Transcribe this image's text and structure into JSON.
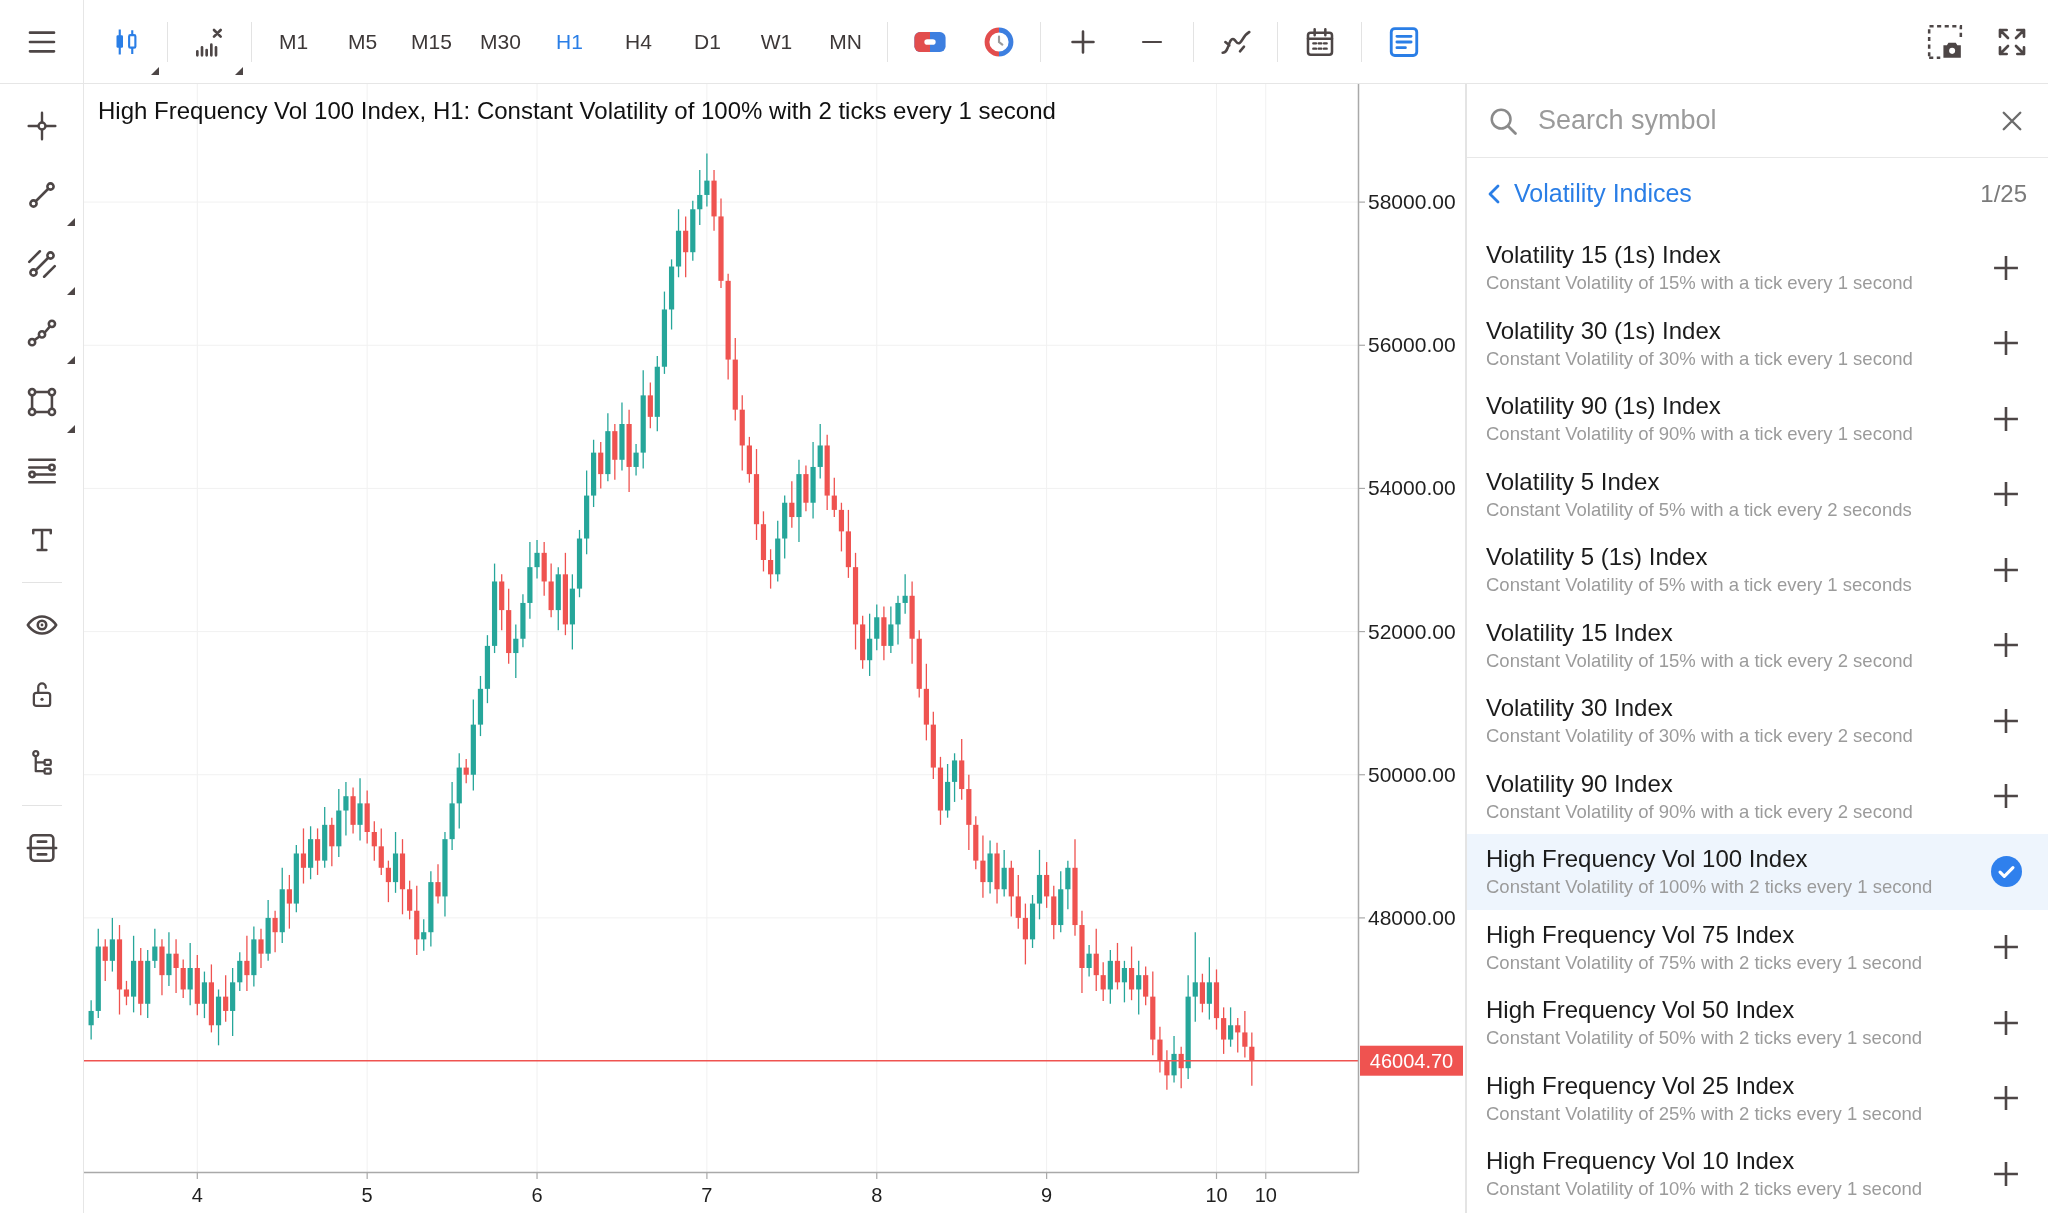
{
  "toolbar": {
    "chart_buttons": [
      {
        "kind": "candles",
        "active": true,
        "menu": true
      },
      {
        "kind": "indicators",
        "active": false,
        "menu": true
      }
    ],
    "timeframes": [
      {
        "label": "M1",
        "selected": false
      },
      {
        "label": "M5",
        "selected": false
      },
      {
        "label": "M15",
        "selected": false
      },
      {
        "label": "M30",
        "selected": false
      },
      {
        "label": "H1",
        "selected": true
      },
      {
        "label": "H4",
        "selected": false
      },
      {
        "label": "D1",
        "selected": false
      },
      {
        "label": "W1",
        "selected": false
      },
      {
        "label": "MN",
        "selected": false
      }
    ],
    "tool_groups": [
      [
        {
          "kind": "toggle",
          "active": false
        },
        {
          "kind": "ring",
          "active": false
        }
      ],
      [
        {
          "kind": "plus",
          "active": false
        },
        {
          "kind": "minus",
          "active": false
        }
      ],
      [
        {
          "kind": "curve",
          "active": false
        }
      ],
      [
        {
          "kind": "calendar",
          "active": false
        }
      ],
      [
        {
          "kind": "document",
          "active": true
        }
      ]
    ],
    "right_buttons": [
      {
        "kind": "camera",
        "active": false
      },
      {
        "kind": "fullscreen",
        "active": false
      }
    ]
  },
  "drawing_tools": [
    [
      {
        "kind": "crosshair",
        "menu": false
      },
      {
        "kind": "trend-line",
        "menu": true
      },
      {
        "kind": "channel",
        "menu": true
      },
      {
        "kind": "polyline",
        "menu": true
      },
      {
        "kind": "rectangle",
        "menu": true
      },
      {
        "kind": "lines",
        "menu": false
      },
      {
        "kind": "text",
        "menu": false
      }
    ],
    [
      {
        "kind": "eye",
        "menu": false
      },
      {
        "kind": "lock",
        "menu": false
      },
      {
        "kind": "tree",
        "menu": false
      }
    ],
    [
      {
        "kind": "stack",
        "menu": false
      }
    ]
  ],
  "chart": {
    "chart_data": [
      {
        "type": "candlestick",
        "title": "High Frequency Vol 100 Index, H1: Constant Volatility of 100% with 2 ticks every 1 second",
        "grid": true,
        "xlim": [
          3.333,
          10.833
        ],
        "ylim": [
          44450,
          59650
        ],
        "xticks": [
          4,
          5,
          6,
          7,
          8,
          9,
          10,
          {
            "value": 10.29,
            "label": "10"
          }
        ],
        "yticks": [
          {
            "value": 48000,
            "label": "48000.00"
          },
          {
            "value": 50000,
            "label": "50000.00"
          },
          {
            "value": 52000,
            "label": "52000.00"
          },
          {
            "value": 54000,
            "label": "54000.00"
          },
          {
            "value": 56000,
            "label": "56000.00"
          },
          {
            "value": 58000,
            "label": "58000.00"
          }
        ],
        "ref_lines": [
          {
            "axis": "y",
            "value": 46004.7,
            "label": "46004.70",
            "color": "#ef5350"
          }
        ],
        "x": [
          3.375,
          3.417,
          3.458,
          3.5,
          3.542,
          3.583,
          3.625,
          3.667,
          3.708,
          3.75,
          3.792,
          3.833,
          3.875,
          3.917,
          3.958,
          4,
          4.042,
          4.083,
          4.125,
          4.167,
          4.208,
          4.25,
          4.292,
          4.333,
          4.375,
          4.417,
          4.458,
          4.5,
          4.542,
          4.583,
          4.625,
          4.667,
          4.708,
          4.75,
          4.792,
          4.833,
          4.875,
          4.917,
          4.958,
          5,
          5.042,
          5.083,
          5.125,
          5.167,
          5.208,
          5.25,
          5.292,
          5.333,
          5.375,
          5.417,
          5.458,
          5.5,
          5.542,
          5.583,
          5.625,
          5.667,
          5.708,
          5.75,
          5.792,
          5.833,
          5.875,
          5.917,
          5.958,
          6,
          6.042,
          6.083,
          6.125,
          6.167,
          6.208,
          6.25,
          6.292,
          6.333,
          6.375,
          6.417,
          6.458,
          6.5,
          6.542,
          6.583,
          6.625,
          6.667,
          6.708,
          6.75,
          6.792,
          6.833,
          6.875,
          6.917,
          6.958,
          7,
          7.042,
          7.083,
          7.125,
          7.167,
          7.208,
          7.25,
          7.292,
          7.333,
          7.375,
          7.417,
          7.458,
          7.5,
          7.542,
          7.583,
          7.625,
          7.667,
          7.708,
          7.75,
          7.792,
          7.833,
          7.875,
          7.917,
          7.958,
          8,
          8.042,
          8.083,
          8.125,
          8.167,
          8.208,
          8.25,
          8.292,
          8.333,
          8.375,
          8.417,
          8.458,
          8.5,
          8.542,
          8.583,
          8.625,
          8.667,
          8.708,
          8.75,
          8.792,
          8.833,
          8.875,
          8.917,
          8.958,
          9,
          9.042,
          9.083,
          9.125,
          9.167,
          9.208,
          9.25,
          9.292,
          9.333,
          9.375,
          9.417,
          9.458,
          9.5,
          9.542,
          9.583,
          9.625,
          9.667,
          9.708,
          9.75,
          9.792,
          9.833,
          9.875,
          9.917,
          9.958,
          10,
          10.042,
          10.083,
          10.125,
          10.167,
          10.208
        ],
        "ohlc": [
          [
            46500,
            46850,
            46300,
            46700
          ],
          [
            46700,
            47850,
            46600,
            47600
          ],
          [
            47600,
            47700,
            47120,
            47400
          ],
          [
            47400,
            48000,
            47250,
            47700
          ],
          [
            47700,
            47900,
            46650,
            47000
          ],
          [
            47000,
            47120,
            46780,
            46900
          ],
          [
            46900,
            47750,
            46680,
            47400
          ],
          [
            47400,
            47580,
            46640,
            46800
          ],
          [
            46800,
            47550,
            46600,
            47400
          ],
          [
            47400,
            47850,
            47300,
            47600
          ],
          [
            47600,
            47700,
            46920,
            47200
          ],
          [
            47200,
            47800,
            47050,
            47500
          ],
          [
            47500,
            47700,
            46950,
            47300
          ],
          [
            47300,
            47420,
            46880,
            47000
          ],
          [
            47000,
            47650,
            46780,
            47300
          ],
          [
            47300,
            47480,
            46640,
            46800
          ],
          [
            46800,
            47250,
            46600,
            47100
          ],
          [
            47100,
            47350,
            46400,
            46500
          ],
          [
            46500,
            47000,
            46220,
            46900
          ],
          [
            46900,
            47200,
            46550,
            46700
          ],
          [
            46700,
            47300,
            46350,
            47100
          ],
          [
            47100,
            47520,
            46980,
            47400
          ],
          [
            47400,
            47750,
            46980,
            47200
          ],
          [
            47200,
            47880,
            47040,
            47700
          ],
          [
            47700,
            47850,
            47300,
            47500
          ],
          [
            47500,
            48250,
            47400,
            48000
          ],
          [
            48000,
            48100,
            47520,
            47800
          ],
          [
            47800,
            48700,
            47650,
            48400
          ],
          [
            48400,
            48600,
            47850,
            48200
          ],
          [
            48200,
            49020,
            48080,
            48900
          ],
          [
            48900,
            49250,
            48480,
            48700
          ],
          [
            48700,
            49280,
            48540,
            49100
          ],
          [
            49100,
            49250,
            48600,
            48800
          ],
          [
            48800,
            49550,
            48700,
            49300
          ],
          [
            49300,
            49400,
            48720,
            49000
          ],
          [
            49000,
            49800,
            48850,
            49500
          ],
          [
            49500,
            49900,
            49150,
            49700
          ],
          [
            49700,
            49820,
            49180,
            49300
          ],
          [
            49300,
            49950,
            49080,
            49600
          ],
          [
            49600,
            49780,
            49040,
            49200
          ],
          [
            49200,
            49350,
            48800,
            49000
          ],
          [
            49000,
            49250,
            48600,
            48700
          ],
          [
            48700,
            48800,
            48220,
            48500
          ],
          [
            48500,
            49200,
            48350,
            48900
          ],
          [
            48900,
            49100,
            48050,
            48400
          ],
          [
            48400,
            48520,
            47980,
            48100
          ],
          [
            48100,
            48450,
            47480,
            47700
          ],
          [
            47700,
            47980,
            47540,
            47800
          ],
          [
            47800,
            48650,
            47600,
            48500
          ],
          [
            48500,
            48750,
            48200,
            48300
          ],
          [
            48300,
            49200,
            48020,
            49100
          ],
          [
            49100,
            49900,
            48950,
            49600
          ],
          [
            49600,
            50300,
            49250,
            50100
          ],
          [
            50100,
            50220,
            49880,
            50000
          ],
          [
            50000,
            51050,
            49780,
            50700
          ],
          [
            50700,
            51380,
            50540,
            51200
          ],
          [
            51200,
            51950,
            51000,
            51800
          ],
          [
            51800,
            52950,
            51700,
            52700
          ],
          [
            52700,
            52800,
            52020,
            52300
          ],
          [
            52300,
            52600,
            51550,
            51700
          ],
          [
            51700,
            52100,
            51350,
            51900
          ],
          [
            51900,
            52520,
            51780,
            52400
          ],
          [
            52400,
            53250,
            52180,
            52900
          ],
          [
            52900,
            53280,
            52740,
            53100
          ],
          [
            53100,
            53250,
            52500,
            52700
          ],
          [
            52700,
            52950,
            52200,
            52300
          ],
          [
            52300,
            52900,
            52020,
            52800
          ],
          [
            52800,
            53100,
            51950,
            52100
          ],
          [
            52100,
            52800,
            51750,
            52600
          ],
          [
            52600,
            53420,
            52480,
            53300
          ],
          [
            53300,
            54250,
            53080,
            53900
          ],
          [
            53900,
            54680,
            53740,
            54500
          ],
          [
            54500,
            54650,
            54000,
            54200
          ],
          [
            54200,
            55050,
            54100,
            54800
          ],
          [
            54800,
            54900,
            54120,
            54400
          ],
          [
            54400,
            55200,
            54250,
            54900
          ],
          [
            54900,
            55100,
            53950,
            54300
          ],
          [
            54300,
            54620,
            54180,
            54500
          ],
          [
            54500,
            55650,
            54280,
            55300
          ],
          [
            55300,
            55480,
            54840,
            55000
          ],
          [
            55000,
            55850,
            54800,
            55700
          ],
          [
            55700,
            56750,
            55600,
            56500
          ],
          [
            56500,
            57200,
            56220,
            57100
          ],
          [
            57100,
            57900,
            56950,
            57600
          ],
          [
            57600,
            57800,
            56950,
            57300
          ],
          [
            57300,
            58020,
            57180,
            57900
          ],
          [
            57900,
            58450,
            57680,
            58100
          ],
          [
            58100,
            58680,
            57940,
            58300
          ],
          [
            58300,
            58450,
            57600,
            57800
          ],
          [
            57800,
            58050,
            56800,
            56900
          ],
          [
            56900,
            57000,
            55520,
            55800
          ],
          [
            55800,
            56100,
            54950,
            55100
          ],
          [
            55100,
            55300,
            54250,
            54600
          ],
          [
            54600,
            54720,
            54080,
            54200
          ],
          [
            54200,
            54550,
            53280,
            53500
          ],
          [
            53500,
            53680,
            52840,
            53000
          ],
          [
            53000,
            53150,
            52600,
            52800
          ],
          [
            52800,
            53550,
            52700,
            53300
          ],
          [
            53300,
            53900,
            53020,
            53800
          ],
          [
            53800,
            54100,
            53450,
            53600
          ],
          [
            53600,
            54400,
            53250,
            54200
          ],
          [
            54200,
            54320,
            53680,
            53800
          ],
          [
            53800,
            54650,
            53580,
            54300
          ],
          [
            54300,
            54900,
            54140,
            54600
          ],
          [
            54600,
            54750,
            53700,
            53900
          ],
          [
            53900,
            54150,
            53600,
            53700
          ],
          [
            53700,
            53800,
            53120,
            53400
          ],
          [
            53400,
            53700,
            52750,
            52900
          ],
          [
            52900,
            53100,
            51750,
            52100
          ],
          [
            52100,
            52220,
            51480,
            51600
          ],
          [
            51600,
            52250,
            51380,
            51900
          ],
          [
            51900,
            52380,
            51740,
            52200
          ],
          [
            52200,
            52350,
            51600,
            51800
          ],
          [
            51800,
            52350,
            51700,
            52100
          ],
          [
            52100,
            52500,
            51820,
            52400
          ],
          [
            52400,
            52800,
            52250,
            52500
          ],
          [
            52500,
            52700,
            51550,
            51900
          ],
          [
            51900,
            52020,
            51080,
            51200
          ],
          [
            51200,
            51550,
            50480,
            50700
          ],
          [
            50700,
            50880,
            49940,
            50100
          ],
          [
            50100,
            50250,
            49300,
            49500
          ],
          [
            49500,
            50150,
            49400,
            49900
          ],
          [
            49900,
            50300,
            49620,
            50200
          ],
          [
            50200,
            50500,
            49650,
            49800
          ],
          [
            49800,
            50000,
            48950,
            49300
          ],
          [
            49300,
            49420,
            48680,
            48800
          ],
          [
            48800,
            49150,
            48280,
            48500
          ],
          [
            48500,
            49080,
            48340,
            48900
          ],
          [
            48900,
            49050,
            48200,
            48400
          ],
          [
            48400,
            48950,
            48300,
            48700
          ],
          [
            48700,
            48800,
            48020,
            48300
          ],
          [
            48300,
            48600,
            47850,
            48000
          ],
          [
            48000,
            48200,
            47350,
            47700
          ],
          [
            47700,
            48320,
            47580,
            48200
          ],
          [
            48200,
            48950,
            47980,
            48600
          ],
          [
            48600,
            48780,
            48140,
            48300
          ],
          [
            48300,
            48450,
            47700,
            47900
          ],
          [
            47900,
            48650,
            47800,
            48400
          ],
          [
            48400,
            48800,
            48120,
            48700
          ],
          [
            48700,
            49100,
            47750,
            47900
          ],
          [
            47900,
            48100,
            46950,
            47300
          ],
          [
            47300,
            47620,
            47180,
            47500
          ],
          [
            47500,
            47850,
            46980,
            47200
          ],
          [
            47200,
            47380,
            46840,
            47000
          ],
          [
            47000,
            47550,
            46800,
            47400
          ],
          [
            47400,
            47650,
            47000,
            47100
          ],
          [
            47100,
            47400,
            46820,
            47300
          ],
          [
            47300,
            47600,
            46850,
            47000
          ],
          [
            47000,
            47400,
            46650,
            47200
          ],
          [
            47200,
            47320,
            46780,
            46900
          ],
          [
            46900,
            47250,
            46080,
            46300
          ],
          [
            46300,
            46480,
            45840,
            46000
          ],
          [
            46000,
            46150,
            45600,
            45800
          ],
          [
            45800,
            46350,
            45700,
            46100
          ],
          [
            46100,
            46200,
            45620,
            45900
          ],
          [
            45900,
            47200,
            45750,
            46900
          ],
          [
            46900,
            47800,
            46550,
            47100
          ],
          [
            47100,
            47220,
            46680,
            46800
          ],
          [
            46800,
            47450,
            46580,
            47100
          ],
          [
            47100,
            47280,
            46440,
            46600
          ],
          [
            46600,
            46750,
            46100,
            46300
          ],
          [
            46300,
            46750,
            46200,
            46500
          ],
          [
            46500,
            46600,
            46120,
            46400
          ],
          [
            46400,
            46700,
            46050,
            46200
          ],
          [
            46200,
            46400,
            45655,
            46005
          ]
        ]
      }
    ]
  },
  "symbol_panel": {
    "search": {
      "placeholder": "Search symbol"
    },
    "category": {
      "title": "Volatility Indices",
      "page": "1/25"
    },
    "symbols": [
      {
        "name": "Volatility 15 (1s) Index",
        "description": "Constant Volatility of 15% with a tick every 1 second",
        "selected": false
      },
      {
        "name": "Volatility 30 (1s) Index",
        "description": "Constant Volatility of 30% with a tick every 1 second",
        "selected": false
      },
      {
        "name": "Volatility 90 (1s) Index",
        "description": "Constant Volatility of 90% with a tick every 1 second",
        "selected": false
      },
      {
        "name": "Volatility 5 Index",
        "description": "Constant Volatility of 5% with a tick every 2 seconds",
        "selected": false
      },
      {
        "name": "Volatility 5 (1s) Index",
        "description": "Constant Volatility of 5% with a tick every 1 seconds",
        "selected": false
      },
      {
        "name": "Volatility 15 Index",
        "description": "Constant Volatility of 15% with a tick every 2 second",
        "selected": false
      },
      {
        "name": "Volatility 30 Index",
        "description": "Constant Volatility of 30% with a tick every 2 second",
        "selected": false
      },
      {
        "name": "Volatility 90 Index",
        "description": "Constant Volatility of 90% with a tick every 2 second",
        "selected": false
      },
      {
        "name": "High Frequency Vol 100 Index",
        "description": "Constant Volatility of 100% with 2 ticks every 1 second",
        "selected": true
      },
      {
        "name": "High Frequency Vol 75 Index",
        "description": "Constant Volatility of 75% with 2 ticks every 1 second",
        "selected": false
      },
      {
        "name": "High Frequency Vol 50 Index",
        "description": "Constant Volatility of 50% with 2 ticks every 1 second",
        "selected": false
      },
      {
        "name": "High Frequency Vol 25 Index",
        "description": "Constant Volatility of 25% with 2 ticks every 1 second",
        "selected": false
      },
      {
        "name": "High Frequency Vol 10 Index",
        "description": "Constant Volatility of 10% with 2 ticks every 1 second",
        "selected": false
      }
    ]
  }
}
